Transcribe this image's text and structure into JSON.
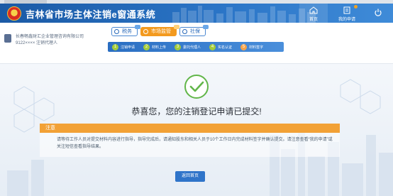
{
  "header": {
    "title": "吉林省市场主体注销e窗通系统",
    "home_label": "首页",
    "my_application_label": "我的申请",
    "colors": {
      "primary": "#2a74c6",
      "accent": "#f39a1f"
    },
    "icons": [
      "national-emblem",
      "home-icon",
      "document-icon",
      "power-icon"
    ]
  },
  "user": {
    "line1": "长春畅鑫财汇企业管理咨询有限公司",
    "line2": "9122×××× 注销代理人"
  },
  "process_tabs": [
    {
      "label": "税务",
      "active": false
    },
    {
      "label": "市场监管",
      "active": true
    },
    {
      "label": "社保",
      "active": false
    }
  ],
  "steps": [
    {
      "num": "1",
      "label": "注销申请"
    },
    {
      "num": "2",
      "label": "材料上传"
    },
    {
      "num": "3",
      "label": "委托代理人"
    },
    {
      "num": "4",
      "label": "实名认证"
    },
    {
      "num": "5",
      "label": "材料签字"
    }
  ],
  "success_message": "恭喜您，您的注销登记申请已提交!",
  "notice": {
    "title": "注意",
    "body": "请等待工作人员对提交材料内容进行指导，指导完成后，请通知股东和相关人员于10个工作日内完成材料签字并确认提交。请注意查看“我的申请”或关注短信查看指导结果。"
  },
  "back_button_label": "返回首页"
}
